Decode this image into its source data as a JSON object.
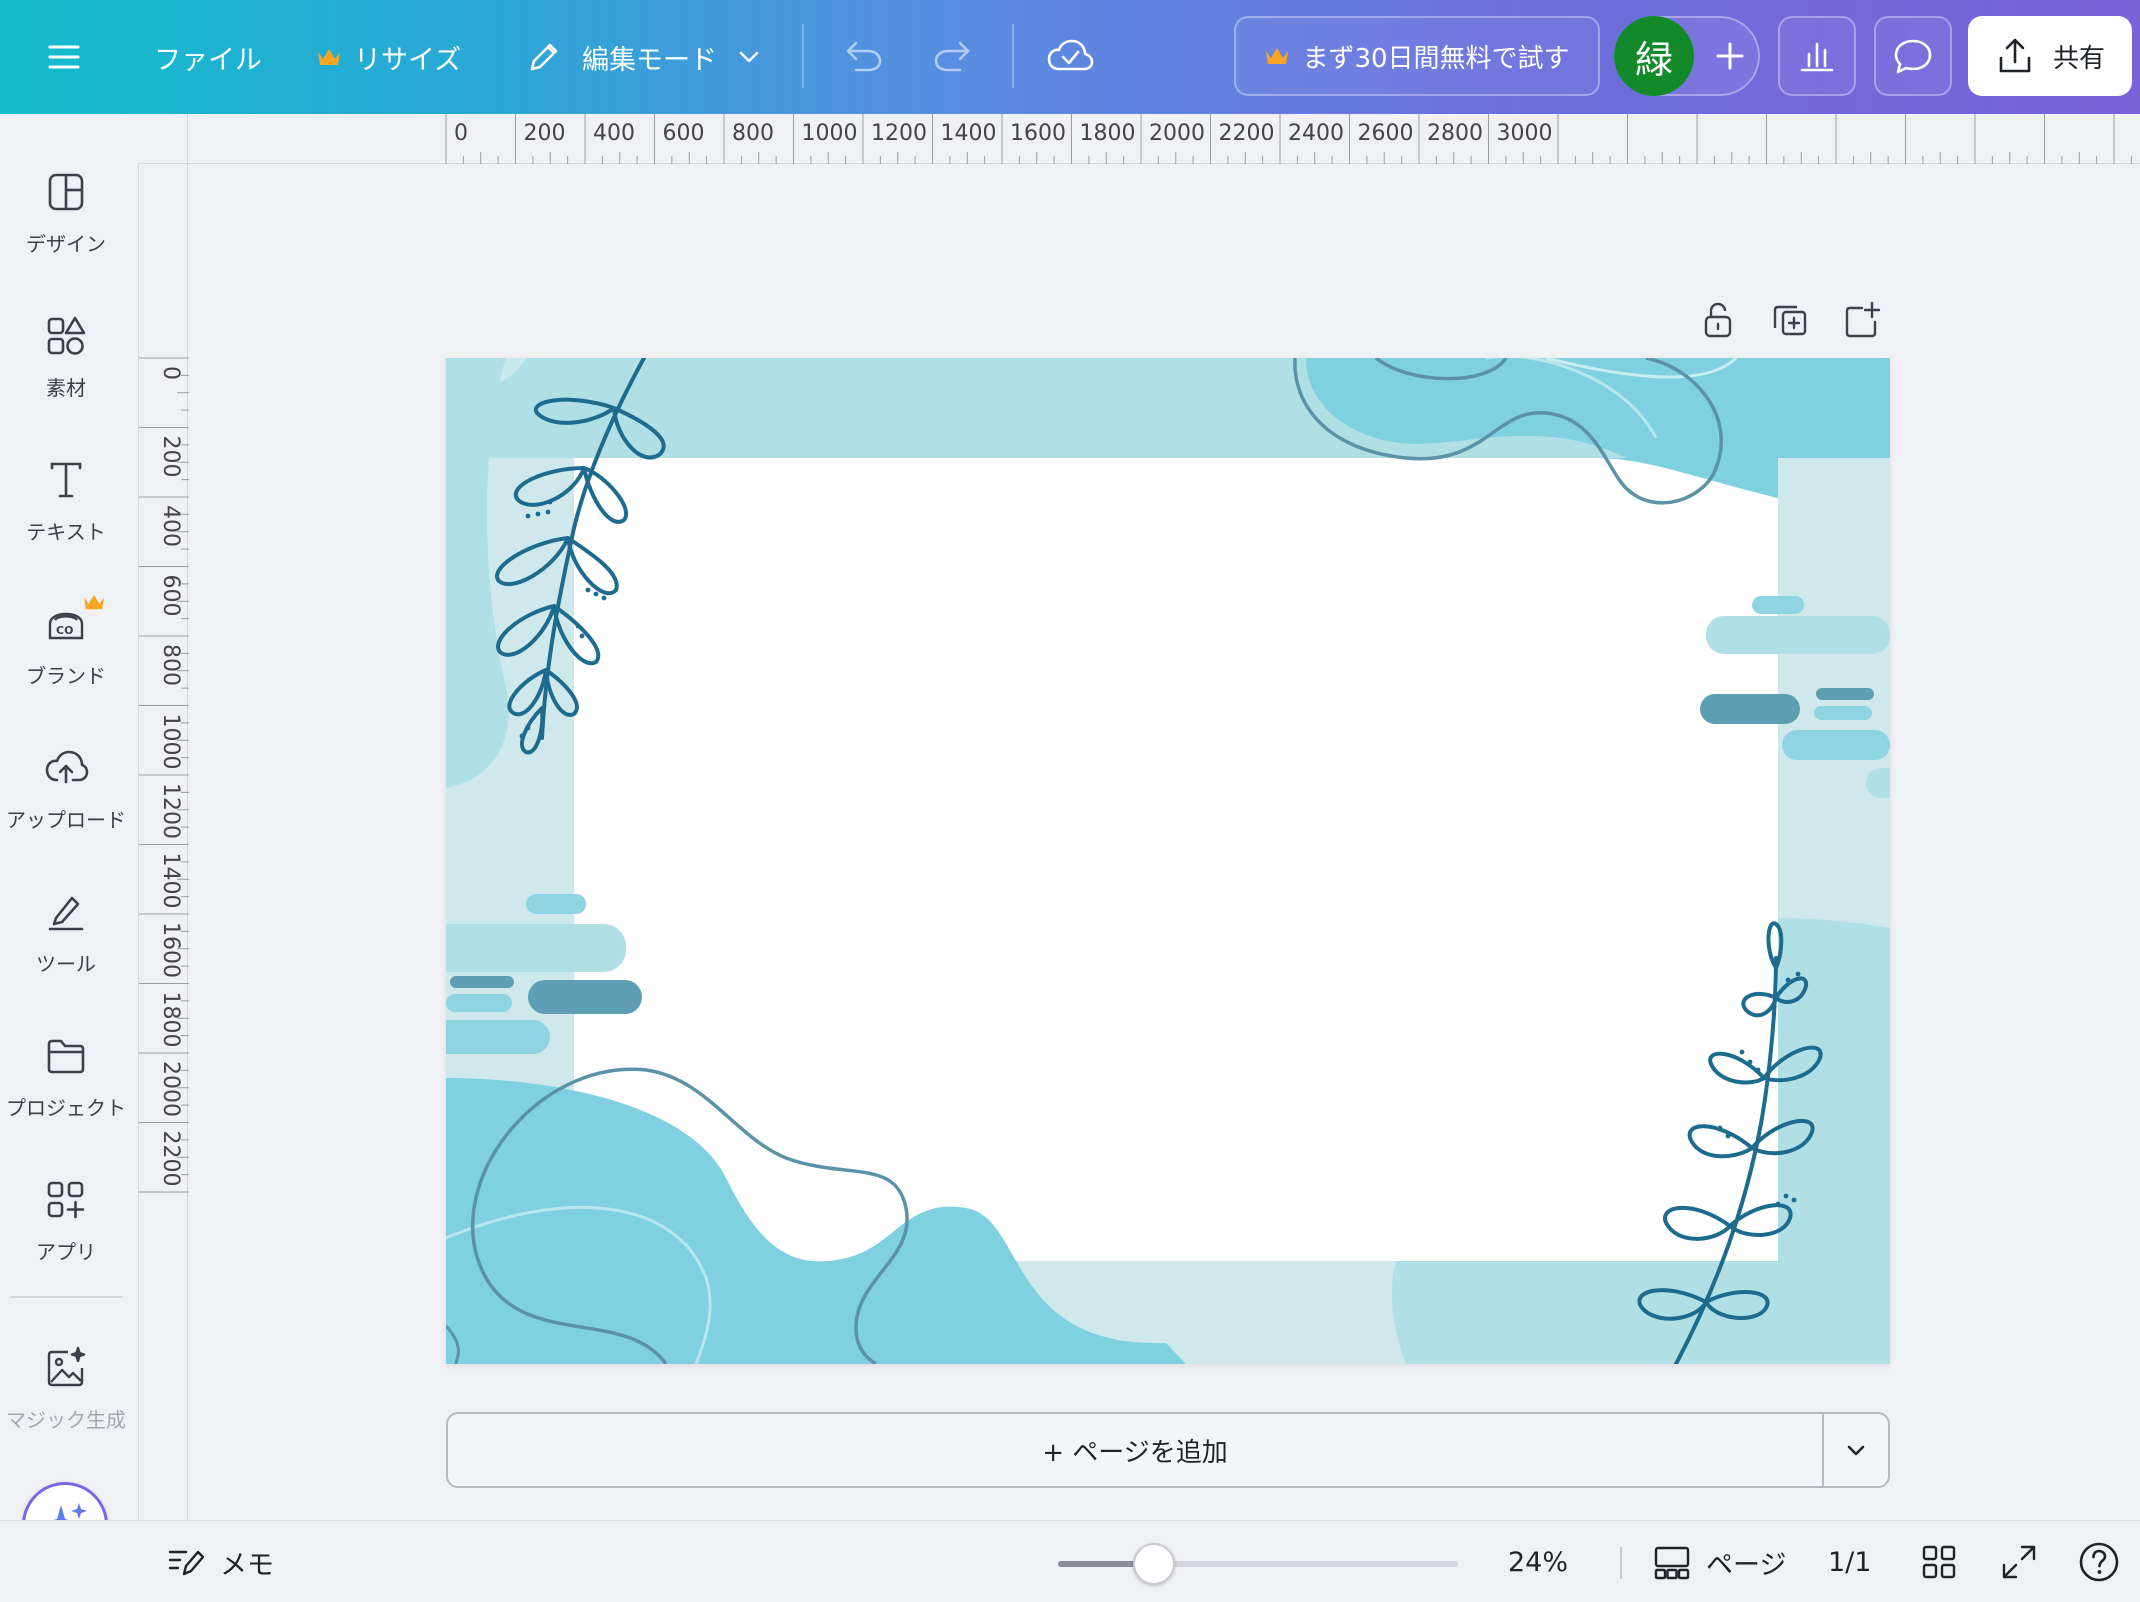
{
  "topbar": {
    "menu_icon": "hamburger-icon",
    "file_label": "ファイル",
    "resize_label": "リサイズ",
    "edit_mode_label": "編集モード",
    "trial_label": "まず30日間無料で試す",
    "avatar_initial": "緑",
    "share_label": "共有"
  },
  "sidebar": {
    "items": [
      {
        "label": "デザイン",
        "icon": "layout-icon"
      },
      {
        "label": "素材",
        "icon": "shapes-icon"
      },
      {
        "label": "テキスト",
        "icon": "text-icon"
      },
      {
        "label": "ブランド",
        "icon": "brand-icon"
      },
      {
        "label": "アップロード",
        "icon": "cloud-upload-icon"
      },
      {
        "label": "ツール",
        "icon": "pen-tool-icon"
      },
      {
        "label": "プロジェクト",
        "icon": "folder-icon"
      },
      {
        "label": "アプリ",
        "icon": "apps-icon"
      },
      {
        "label": "マジック生成",
        "icon": "magic-image-icon"
      }
    ]
  },
  "ruler": {
    "top": [
      "0",
      "200",
      "400",
      "600",
      "800",
      "1000",
      "1200",
      "1400",
      "1600",
      "1800",
      "2000",
      "2200",
      "2400",
      "2600",
      "2800",
      "3000"
    ],
    "left": [
      "0",
      "200",
      "400",
      "600",
      "800",
      "1000",
      "1200",
      "1400",
      "1600",
      "1800",
      "2000",
      "2200"
    ]
  },
  "canvas": {
    "add_page_label": "+ ページを追加"
  },
  "bottombar": {
    "notes_label": "メモ",
    "zoom_value": 0.24,
    "zoom_label": "24%",
    "pages_label": "ページ",
    "page_count": "1/1"
  },
  "colors": {
    "accent_green": "#128a2a",
    "crown": "#f6a623"
  }
}
